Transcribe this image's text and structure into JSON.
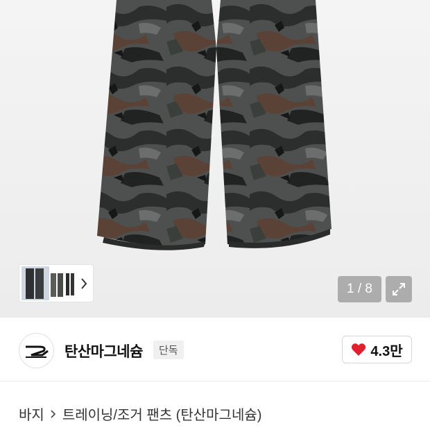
{
  "gallery": {
    "image_alt": "camouflage wide training pants",
    "counter": "1 / 8",
    "thumbnail_next_icon": "chevron-right-icon",
    "expand_icon": "expand-icon"
  },
  "brand": {
    "name": "탄산마그네슘",
    "badge": "단독",
    "logo_icon": "brand-logo-icon",
    "likes": "4.3만",
    "like_icon": "heart-icon",
    "like_color": "#e0202c"
  },
  "breadcrumb": {
    "items": [
      "바지",
      "트레이닝/조거 팬츠 (탄산마그네슘)"
    ],
    "separator_icon": "chevron-right-icon"
  }
}
